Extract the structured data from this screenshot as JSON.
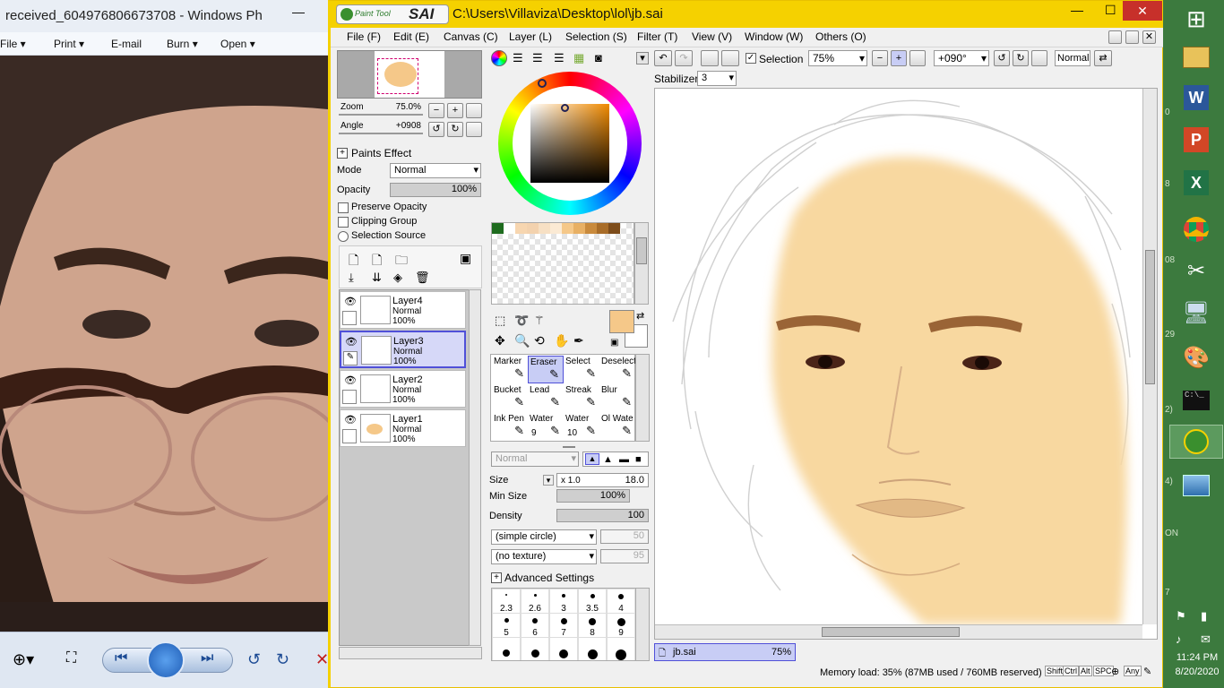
{
  "photo_viewer": {
    "title": "received_604976806673708 - Windows Ph",
    "menu": [
      "File",
      "Print",
      "E-mail",
      "Burn",
      "Open"
    ]
  },
  "sai": {
    "logo": "SAI",
    "logo_small": "Paint Tool",
    "path": "C:\\Users\\Villaviza\\Desktop\\lol\\jb.sai",
    "menu": [
      "File (F)",
      "Edit (E)",
      "Canvas (C)",
      "Layer (L)",
      "Selection (S)",
      "Filter (T)",
      "View (V)",
      "Window (W)",
      "Others (O)"
    ],
    "toolbar": {
      "selection_label": "Selection",
      "zoom": "75%",
      "angle": "+090°",
      "mode": "Normal",
      "stabilizer_label": "Stabilizer",
      "stabilizer_value": "3"
    },
    "navigator": {
      "zoom_label": "Zoom",
      "zoom_value": "75.0%",
      "angle_label": "Angle",
      "angle_value": "+0908"
    },
    "paints_effect": {
      "header": "Paints Effect",
      "mode_label": "Mode",
      "mode_value": "Normal",
      "opacity_label": "Opacity",
      "opacity_value": "100%",
      "preserve_opacity": "Preserve Opacity",
      "clipping_group": "Clipping Group",
      "selection_source": "Selection Source"
    },
    "layers": [
      {
        "name": "Layer4",
        "mode": "Normal",
        "opacity": "100%"
      },
      {
        "name": "Layer3",
        "mode": "Normal",
        "opacity": "100%"
      },
      {
        "name": "Layer2",
        "mode": "Normal",
        "opacity": "100%"
      },
      {
        "name": "Layer1",
        "mode": "Normal",
        "opacity": "100%"
      }
    ],
    "swatches": [
      "#1e6b1e",
      "#ffffff",
      "#f7d6b0",
      "#f3d2ae",
      "#f7e0c4",
      "#fbead4",
      "#f5c889",
      "#e8b064",
      "#c98a3c",
      "#a86c28",
      "#7d4c1a"
    ],
    "tools": [
      {
        "name": "Marker",
        "num": ""
      },
      {
        "name": "Eraser",
        "num": ""
      },
      {
        "name": "Select",
        "num": ""
      },
      {
        "name": "Deselect",
        "num": ""
      },
      {
        "name": "Bucket",
        "num": ""
      },
      {
        "name": "Lead",
        "num": ""
      },
      {
        "name": "Streak",
        "num": ""
      },
      {
        "name": "Blur",
        "num": ""
      },
      {
        "name": "Ink Pen",
        "num": ""
      },
      {
        "name": "Water",
        "num": "9"
      },
      {
        "name": "Water",
        "num": "10"
      },
      {
        "name": "Ol Wate",
        "num": ""
      }
    ],
    "brush": {
      "blend_mode": "Normal",
      "size_label": "Size",
      "size_mult": "x 1.0",
      "size_value": "18.0",
      "min_size_label": "Min Size",
      "min_size_value": "100%",
      "density_label": "Density",
      "density_value": "100",
      "shape": "(simple circle)",
      "shape_value": "50",
      "texture": "(no texture)",
      "texture_value": "95",
      "advanced": "Advanced Settings"
    },
    "brush_sizes": [
      "2.3",
      "2.6",
      "3",
      "3.5",
      "4",
      "5",
      "6",
      "7",
      "8",
      "9"
    ],
    "foreground_color": "#f5c889",
    "doc_tab": {
      "name": "jb.sai",
      "zoom": "75%"
    },
    "status": {
      "memory": "Memory load: 35% (87MB used / 760MB reserved)",
      "keys": [
        "Shift",
        "Ctrl",
        "Alt",
        "SPC",
        "Any"
      ]
    }
  },
  "taskbar": {
    "time": "11:24 PM",
    "date": "8/20/2020",
    "edge_numbers": [
      "0",
      "8",
      "08",
      "29",
      "2)",
      "4)",
      "ON",
      "7"
    ]
  }
}
